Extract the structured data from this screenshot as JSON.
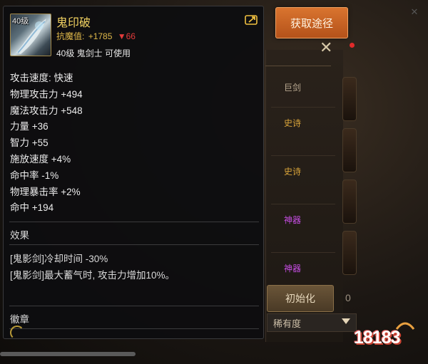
{
  "item": {
    "name": "鬼印破",
    "level_badge": "40级",
    "resist_label": "抗魔值:",
    "resist_value": "+1785",
    "resist_drop": "▼66",
    "requirement": "40级 鬼剑士 可使用",
    "stats": [
      "攻击速度: 快速",
      "物理攻击力 +494",
      "魔法攻击力 +548",
      "力量 +36",
      "智力 +55",
      "施放速度 +4%",
      "命中率 -1%",
      "物理暴击率 +2%",
      "命中 +194"
    ],
    "effect_title": "效果",
    "effects": [
      "[鬼影剑]冷却时间 -30%",
      "[鬼影剑]最大蓄气时, 攻击力增加10%。"
    ],
    "emblem_title": "徽章"
  },
  "background": {
    "acquire_button": "获取途径",
    "grade_labels": [
      "巨剑",
      "史诗",
      "史诗",
      "神器",
      "神器"
    ],
    "init_button": "初始化",
    "side_number": "0",
    "rarity_select": "稀有度"
  },
  "watermark": "18183",
  "colors": {
    "item_name": "#f2d262",
    "epic": "#d9a43a",
    "legendary": "#c64de3",
    "acquire_button": "#c9642a"
  },
  "icons": {
    "share": "share-icon",
    "close": "close-icon",
    "dropdown": "chevron-down-icon"
  }
}
